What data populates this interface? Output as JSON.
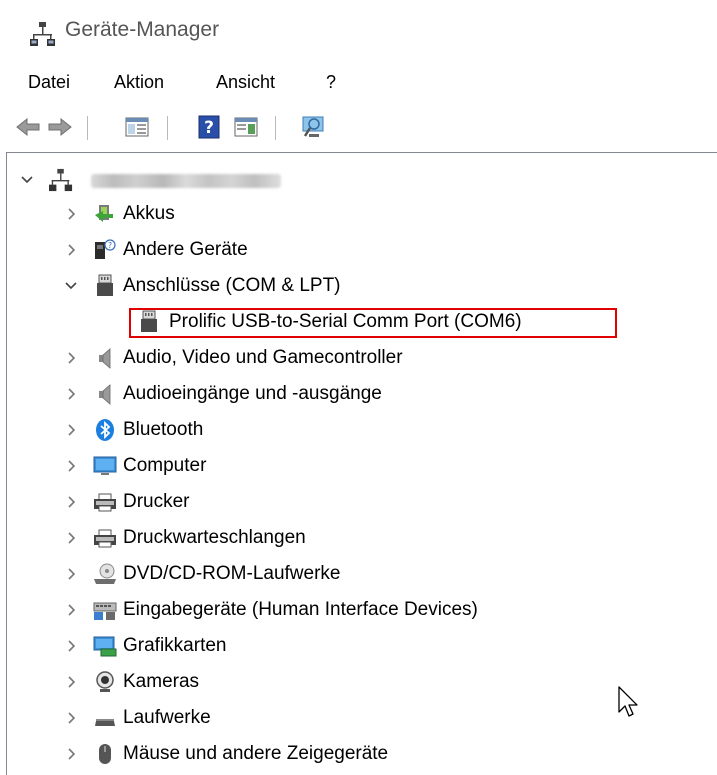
{
  "window": {
    "title": "Geräte-Manager",
    "icon": "device-manager-icon"
  },
  "menu": {
    "file": "Datei",
    "action": "Aktion",
    "view": "Ansicht",
    "help": "?"
  },
  "toolbar": {
    "icons": [
      "back-arrow-icon",
      "forward-arrow-icon",
      "show-hide-console-tree-icon",
      "help-icon",
      "properties-icon",
      "scan-hardware-icon"
    ]
  },
  "tree": {
    "root_icon": "computer-network-icon",
    "nodes": [
      {
        "label": "Akkus",
        "icon": "battery-icon",
        "expanded": false
      },
      {
        "label": "Andere Geräte",
        "icon": "unknown-device-icon",
        "expanded": false
      },
      {
        "label": "Anschlüsse (COM & LPT)",
        "icon": "port-connector-icon",
        "expanded": true
      },
      {
        "label": "Prolific USB-to-Serial Comm Port (COM6)",
        "icon": "port-connector-icon",
        "child": true,
        "highlighted": true
      },
      {
        "label": "Audio, Video und Gamecontroller",
        "icon": "speaker-icon",
        "expanded": false
      },
      {
        "label": "Audioeingänge und -ausgänge",
        "icon": "speaker-icon",
        "expanded": false
      },
      {
        "label": "Bluetooth",
        "icon": "bluetooth-icon",
        "expanded": false
      },
      {
        "label": "Computer",
        "icon": "monitor-icon",
        "expanded": false
      },
      {
        "label": "Drucker",
        "icon": "printer-icon",
        "expanded": false
      },
      {
        "label": "Druckwarteschlangen",
        "icon": "printer-icon",
        "expanded": false
      },
      {
        "label": "DVD/CD-ROM-Laufwerke",
        "icon": "dvd-drive-icon",
        "expanded": false
      },
      {
        "label": "Eingabegeräte (Human Interface Devices)",
        "icon": "keyboard-icon",
        "expanded": false
      },
      {
        "label": "Grafikkarten",
        "icon": "display-adapter-icon",
        "expanded": false
      },
      {
        "label": "Kameras",
        "icon": "camera-icon",
        "expanded": false
      },
      {
        "label": "Laufwerke",
        "icon": "disk-drive-icon",
        "expanded": false
      },
      {
        "label": "Mäuse und andere Zeigegeräte",
        "icon": "mouse-icon",
        "expanded": false
      }
    ]
  },
  "colors": {
    "highlight_border": "#e00000",
    "bluetooth": "#1c7fe0"
  }
}
